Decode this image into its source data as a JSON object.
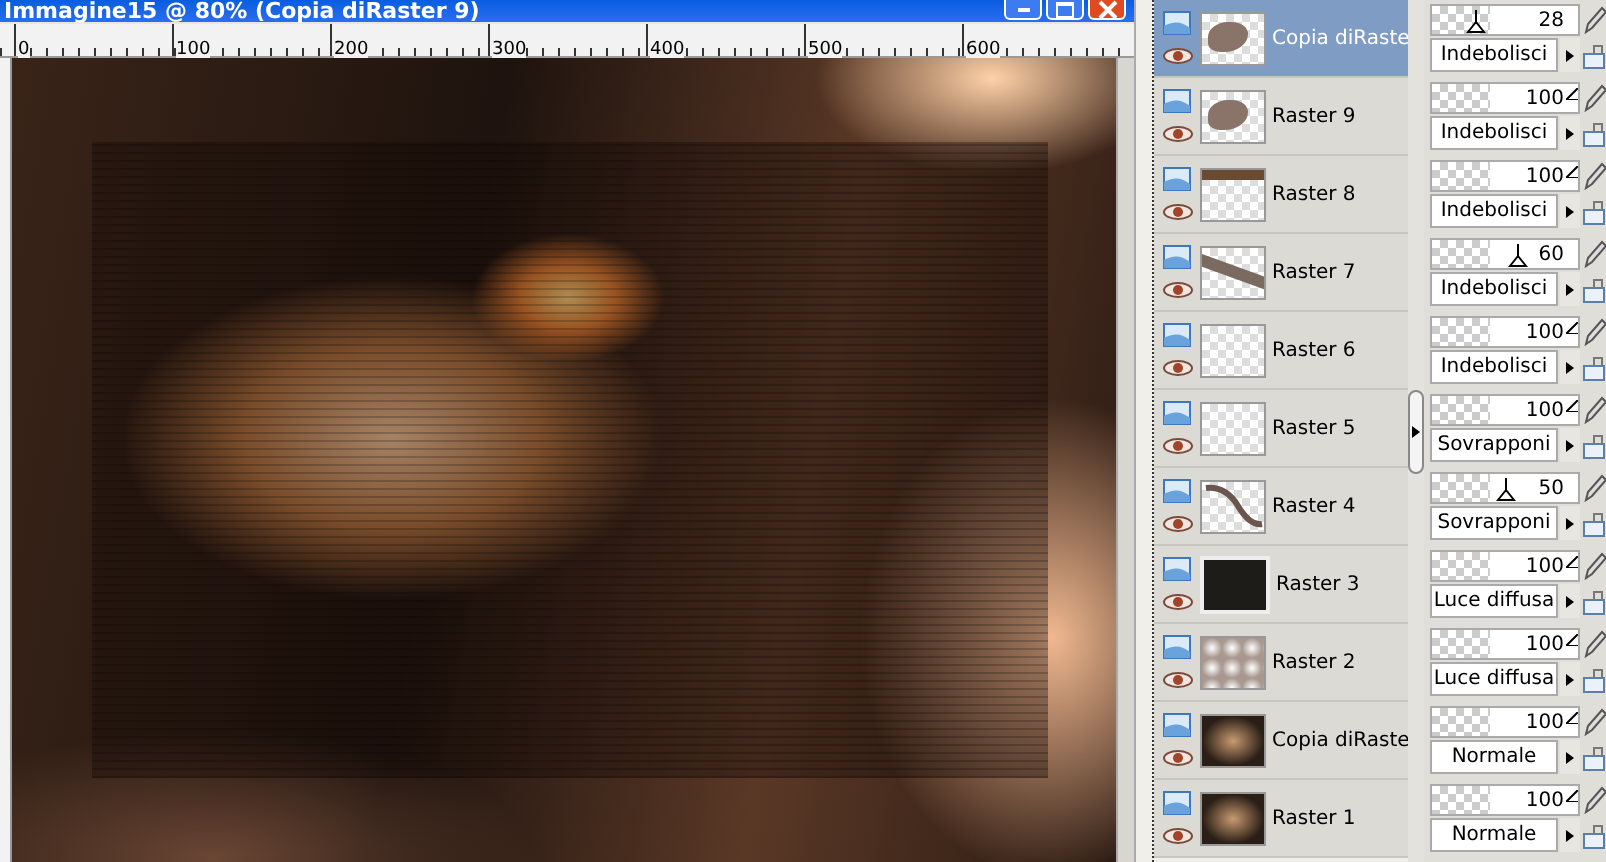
{
  "window": {
    "title": "Immagine15 @ 80% (Copia diRaster 9)"
  },
  "ruler": {
    "ticks": [
      "0",
      "100",
      "200",
      "300",
      "400",
      "500",
      "600"
    ]
  },
  "layers": [
    {
      "name": "Copia diRaste",
      "kind": "shape",
      "selected": true,
      "opacity": "28",
      "level": 0.28,
      "blend": "Indebolisci"
    },
    {
      "name": "Raster 9",
      "kind": "shape",
      "selected": false,
      "opacity": "100",
      "level": 1,
      "blend": "Indebolisci"
    },
    {
      "name": "Raster 8",
      "kind": "top",
      "selected": false,
      "opacity": "100",
      "level": 1,
      "blend": "Indebolisci"
    },
    {
      "name": "Raster 7",
      "kind": "band",
      "selected": false,
      "opacity": "60",
      "level": 0.6,
      "blend": "Indebolisci"
    },
    {
      "name": "Raster 6",
      "kind": "empty",
      "selected": false,
      "opacity": "100",
      "level": 1,
      "blend": "Indebolisci"
    },
    {
      "name": "Raster 5",
      "kind": "empty",
      "selected": false,
      "opacity": "100",
      "level": 1,
      "blend": "Sovrapponi"
    },
    {
      "name": "Raster 4",
      "kind": "curve",
      "selected": false,
      "opacity": "50",
      "level": 0.5,
      "blend": "Sovrapponi"
    },
    {
      "name": "Raster 3",
      "kind": "dark",
      "selected": false,
      "opacity": "100",
      "level": 1,
      "blend": "Luce diffusa"
    },
    {
      "name": "Raster 2",
      "kind": "pattern",
      "selected": false,
      "opacity": "100",
      "level": 1,
      "blend": "Luce diffusa"
    },
    {
      "name": "Copia diRaste",
      "kind": "photo",
      "selected": false,
      "opacity": "100",
      "level": 1,
      "blend": "Normale"
    },
    {
      "name": "Raster 1",
      "kind": "photo",
      "selected": false,
      "opacity": "100",
      "level": 1,
      "blend": "Normale"
    }
  ]
}
